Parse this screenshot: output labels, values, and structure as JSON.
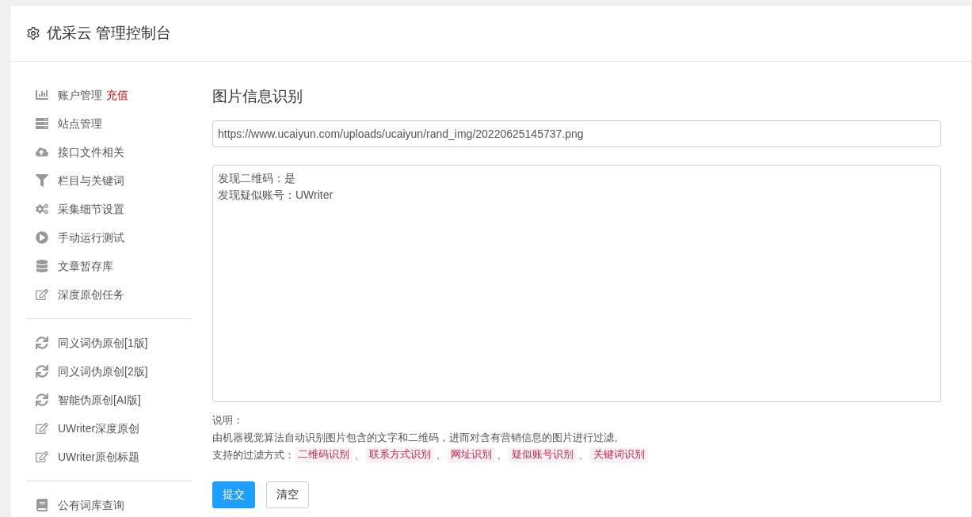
{
  "header": {
    "title": "优采云 管理控制台"
  },
  "sidebar": {
    "groups": [
      {
        "items": [
          {
            "label": "账户管理",
            "extra": "充值"
          },
          {
            "label": "站点管理"
          },
          {
            "label": "接口文件相关"
          },
          {
            "label": "栏目与关键词"
          },
          {
            "label": "采集细节设置"
          },
          {
            "label": "手动运行测试"
          },
          {
            "label": "文章暂存库"
          },
          {
            "label": "深度原创任务"
          }
        ]
      },
      {
        "items": [
          {
            "label": "同义词伪原创[1版]"
          },
          {
            "label": "同义词伪原创[2版]"
          },
          {
            "label": "智能伪原创[AI版]"
          },
          {
            "label": "UWriter深度原创"
          },
          {
            "label": "UWriter原创标题"
          }
        ]
      },
      {
        "items": [
          {
            "label": "公有词库查询"
          }
        ]
      }
    ]
  },
  "main": {
    "title": "图片信息识别",
    "url_field": {
      "value": "https://www.ucaiyun.com/uploads/ucaiyun/rand_img/20220625145737.png"
    },
    "result_box": {
      "lines": [
        "发现二维码：是",
        "发现疑似账号：UWriter"
      ]
    },
    "notes": {
      "heading": "说明：",
      "description": "由机器视觉算法自动识别图片包含的文字和二维码，进而对含有营销信息的图片进行过滤。",
      "methods_label": "支持的过滤方式：",
      "separator": "、",
      "methods": [
        "二维码识别",
        "联系方式识别",
        "网址识别",
        "疑似账号识别",
        "关键词识别"
      ]
    },
    "buttons": [
      {
        "label": "提交",
        "kind": "primary"
      },
      {
        "label": "清空",
        "kind": "default"
      }
    ]
  }
}
